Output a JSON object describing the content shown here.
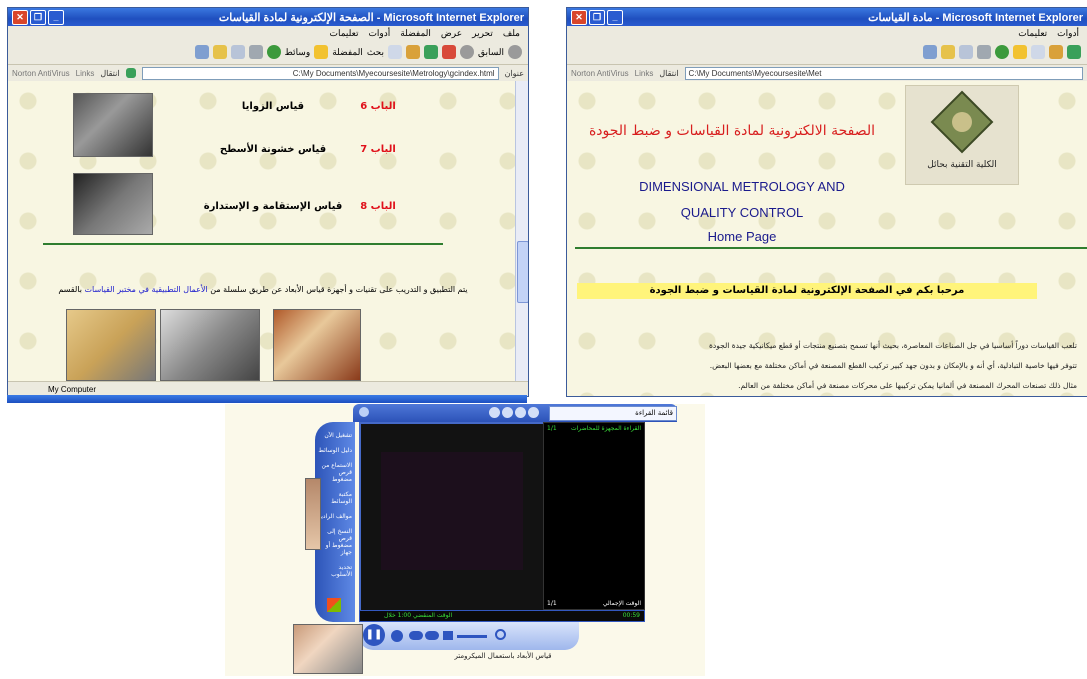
{
  "window_left": {
    "title": "الصفحة الإلكترونية لمادة القياسات - Microsoft Internet Explorer",
    "menu": [
      "ملف",
      "تحرير",
      "عرض",
      "المفضلة",
      "أدوات",
      "تعليمات"
    ],
    "toolbar": {
      "back": "السابق",
      "search": "بحث",
      "favorites": "المفضلة",
      "mail": "وسائط"
    },
    "address_label": "عنوان",
    "address": "C:\\My Documents\\Myecoursesite\\Metrology\\gcindex.html",
    "go_label": "انتقال",
    "links_label": "Links",
    "norton_label": "Norton AntiVirus",
    "rows": [
      {
        "label": "قياس الزوايا",
        "num": "الباب 6"
      },
      {
        "label": "قياس خشونة الأسطح",
        "num": "الباب 7"
      },
      {
        "label": "قياس الإستقامة و الإستدارة",
        "num": "الباب 8"
      }
    ],
    "paragraph_start": "يتم التطبيق و التدريب على تقنيات و أجهزة قياس الأبعاد عن طريق سلسلة من ",
    "paragraph_link": "الأعمال التطبيقية في مختبر القياسات",
    "paragraph_end": " بالقسم",
    "status": "My Computer"
  },
  "window_right": {
    "title": "مادة القياسات - Microsoft Internet Explorer",
    "menu": [
      "أدوات",
      "تعليمات"
    ],
    "address": "C:\\My Documents\\Myecoursesite\\Met",
    "go_label": "انتقال",
    "links_label": "Links",
    "norton_label": "Norton AntiVirus",
    "heading_ar": "الصفحة الالكترونية لمادة القياسات و ضبط الجودة",
    "heading_en_1": "DIMENSIONAL METROLOGY AND",
    "heading_en_2": "QUALITY CONTROL",
    "heading_en_3": "Home Page",
    "logo_caption": "الكلية التقنية بحائل",
    "welcome": "مرحبا بكم في الصفحة الإلكترونية لمادة القياسات و ضبط الجودة",
    "body_text": [
      "تلعب القياسات دوراً أساسيا في جل الصناعات المعاصرة، بحيث أنها تسمح بتصنيع منتجات أو قطع ميكانيكية جيدة الجودة",
      "تتوفر فيها خاصية التبادلية، أي أنه و بالإمكان و بدون جهد كبير تركيب القطع المصنعة في أماكن مختلفة مع بعضها البعض.",
      "مثال ذلك تصنعات المحرك المصنعة في ألمانيا يمكن تركيبها على محركات مصنعة في أماكن مختلفة من العالم."
    ]
  },
  "media_player": {
    "playlist_title": "قائمة القراءة",
    "playlist_item": "القراءة المجهزة للمحاضرات",
    "playlist_count": "1/1",
    "total_time_label": "الوقت الإجمالي",
    "total_time": "1/1",
    "elapsed": "00:59",
    "status_line": "الوقت المنقضي 1:00 خلال",
    "caption": "قياس الأبعاد باستعمال الميكرومتر",
    "nav_items": [
      "تشغيل الآن",
      "دليل الوسائط",
      "الاستماع من قرص مضغوط",
      "مكتبة الوسائط",
      "موالف الراديو",
      "النسخ إلى قرص مضغوط أو جهاز",
      "تحديد الأسلوب"
    ]
  },
  "colors": {
    "title_blue": "#2a5bd0",
    "heading_red": "#d81e1e",
    "heading_blue": "#1a1a8c",
    "highlight_yellow": "#fff47a",
    "rule_green": "#2f7d2f",
    "link_blue": "#1b1bcc"
  }
}
